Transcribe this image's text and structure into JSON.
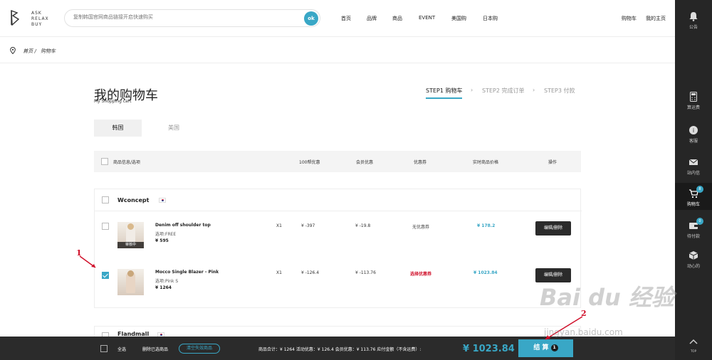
{
  "header": {
    "logo_text": [
      "ASK",
      "RELAX",
      "BUY"
    ],
    "search_placeholder": "复制韩国官网商品链接开启快速购买",
    "search_button": "ok",
    "nav": [
      "首页",
      "品牌",
      "商品",
      "EVENT",
      "美国购",
      "日本购"
    ],
    "nav_right": [
      "购物车",
      "我的主页"
    ]
  },
  "sidebar": {
    "items": [
      {
        "label": "公告",
        "icon": "bell-icon"
      },
      {
        "label": "算运费",
        "icon": "calculator-icon"
      },
      {
        "label": "客服",
        "icon": "support-icon"
      },
      {
        "label": "站内信",
        "icon": "mail-icon"
      },
      {
        "label": "购物车",
        "icon": "cart-icon",
        "badge": "8",
        "active": true
      },
      {
        "label": "待付款",
        "icon": "wallet-icon",
        "badge": "0"
      },
      {
        "label": "动心的",
        "icon": "box-icon"
      },
      {
        "label": "TOP",
        "icon": "arrow-up-icon"
      }
    ]
  },
  "breadcrumb": {
    "home": "首页 /",
    "current": "购物车"
  },
  "page": {
    "title": "我的购物车",
    "subtitle": "My Shopping cart",
    "steps": [
      "STEP1 购物车",
      "STEP2 完成订单",
      "STEP3 付款"
    ],
    "tabs": [
      "韩国",
      "美国"
    ]
  },
  "table": {
    "headers": [
      "商品信息/选项",
      "100帮优惠",
      "会员优惠",
      "优惠券",
      "实时商品价格",
      "操作"
    ]
  },
  "store": {
    "name": "Wconcept",
    "items": [
      {
        "name": "Denim off shoulder top",
        "option": "选项:FREE",
        "price": "¥ 595",
        "tag": "审核中",
        "qty": "X1",
        "discount_100": "¥ -397",
        "member_discount": "¥ -19.8",
        "coupon": "无优惠券",
        "real_price": "¥ 178.2",
        "action": "编辑/删除",
        "checked": false
      },
      {
        "name": "Mocco Single Blazer - Pink",
        "option": "选项:Pink S",
        "price": "¥ 1264",
        "qty": "X1",
        "discount_100": "¥ -126.4",
        "member_discount": "¥ -113.76",
        "coupon": "选择优惠券",
        "real_price": "¥ 1023.84",
        "action": "编辑/删除",
        "checked": true
      }
    ]
  },
  "store2": {
    "name": "Flandmall"
  },
  "bottom": {
    "select_all": "全选",
    "delete_selected": "删除已选商品",
    "clear_invalid": "清空失效商品",
    "summary": "商品合计：¥ 1264   活动优惠：¥ 126.4   会员优惠：¥ 113.76   应付金额（不含运费）:",
    "total": "¥ 1023.84",
    "checkout": "结 算",
    "checkout_count": "1"
  },
  "annotations": [
    "1",
    "2"
  ],
  "watermark": {
    "main": "Bai du 经验",
    "sub": "jingyan.baidu.com"
  },
  "colors": {
    "accent": "#39a7c6",
    "dark": "#2b2b2b",
    "red": "#d0102a"
  }
}
